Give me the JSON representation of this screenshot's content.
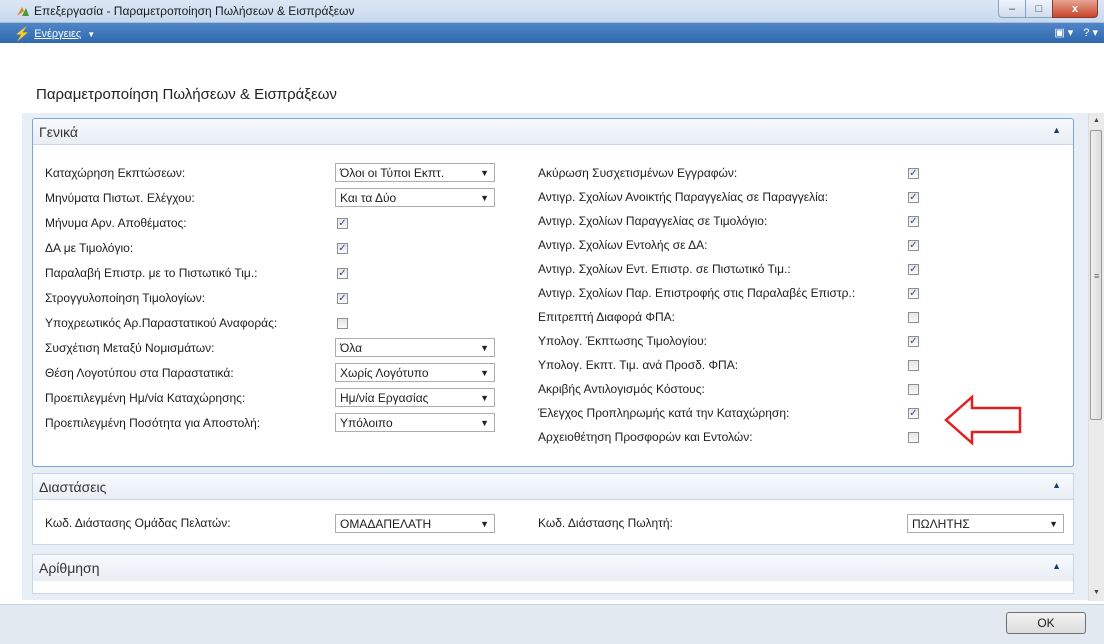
{
  "window": {
    "title": "Επεξεργασία - Παραμετροποίηση Πωλήσεων & Εισπράξεων",
    "minimize": "‒",
    "maximize": "□",
    "close": "x"
  },
  "actionbar": {
    "actions_label": "Ενέργειες",
    "help_glyph": "?"
  },
  "page": {
    "title": "Παραμετροποίηση Πωλήσεων & Εισπράξεων"
  },
  "general": {
    "header": "Γενικά",
    "left_fields": [
      {
        "label": "Καταχώρηση Εκπτώσεων:",
        "type": "combo",
        "value": "Όλοι οι Τύποι Εκπτ."
      },
      {
        "label": "Μηνύματα Πιστωτ. Ελέγχου:",
        "type": "combo",
        "value": "Και τα Δύο"
      },
      {
        "label": "Μήνυμα Αρν. Αποθέματος:",
        "type": "check",
        "checked": true
      },
      {
        "label": "ΔΑ με Τιμολόγιο:",
        "type": "check",
        "checked": true
      },
      {
        "label": "Παραλαβή Επιστρ. με το Πιστωτικό Τιμ.:",
        "type": "check",
        "checked": true
      },
      {
        "label": "Στρογγυλοποίηση Τιμολογίων:",
        "type": "check",
        "checked": true
      },
      {
        "label": "Υποχρεωτικός Αρ.Παραστατικού Αναφοράς:",
        "type": "check",
        "checked": false
      },
      {
        "label": "Συσχέτιση Μεταξύ Νομισμάτων:",
        "type": "combo",
        "value": "Όλα"
      },
      {
        "label": "Θέση Λογοτύπου στα Παραστατικά:",
        "type": "combo",
        "value": "Χωρίς Λογότυπο"
      },
      {
        "label": "Προεπιλεγμένη Ημ/νία Καταχώρησης:",
        "type": "combo",
        "value": "Ημ/νία Εργασίας"
      },
      {
        "label": "Προεπιλεγμένη Ποσότητα για Αποστολή:",
        "type": "combo",
        "value": "Υπόλοιπο"
      }
    ],
    "right_fields": [
      {
        "label": "Ακύρωση Συσχετισμένων Εγγραφών:",
        "checked": true
      },
      {
        "label": "Αντιγρ. Σχολίων Ανοικτής Παραγγελίας σε Παραγγελία:",
        "checked": true
      },
      {
        "label": "Αντιγρ. Σχολίων Παραγγελίας σε Τιμολόγιο:",
        "checked": true
      },
      {
        "label": "Αντιγρ. Σχολίων Εντολής σε ΔΑ:",
        "checked": true
      },
      {
        "label": "Αντιγρ. Σχολίων Εντ. Επιστρ. σε Πιστωτικό Τιμ.:",
        "checked": true
      },
      {
        "label": "Αντιγρ. Σχολίων Παρ. Επιστροφής στις Παραλαβές Επιστρ.:",
        "checked": true
      },
      {
        "label": "Επιτρεπτή Διαφορά ΦΠΑ:",
        "checked": false
      },
      {
        "label": "Υπολογ. Έκπτωσης Τιμολογίου:",
        "checked": true
      },
      {
        "label": "Υπολογ. Εκπτ. Τιμ. ανά Προσδ. ΦΠΑ:",
        "checked": false
      },
      {
        "label": "Ακριβής Αντιλογισμός Κόστους:",
        "checked": false
      },
      {
        "label": "Έλεγχος Προπληρωμής κατά την Καταχώρηση:",
        "checked": true
      },
      {
        "label": "Αρχειοθέτηση Προσφορών και Εντολών:",
        "checked": false
      }
    ]
  },
  "dimensions": {
    "header": "Διαστάσεις",
    "customer_group_label": "Κωδ. Διάστασης Ομάδας Πελατών:",
    "customer_group_value": "ΟΜΑΔΑΠΕΛΑΤΗ",
    "salesperson_label": "Κωδ. Διάστασης Πωλητή:",
    "salesperson_value": "ΠΩΛΗΤΗΣ"
  },
  "numbering": {
    "header": "Αρίθμηση"
  },
  "footer": {
    "ok_label": "OK"
  },
  "colors": {
    "actionbar": "#3a73b8",
    "focus_border": "#7ba4d8",
    "annotation_arrow": "#e02020"
  }
}
